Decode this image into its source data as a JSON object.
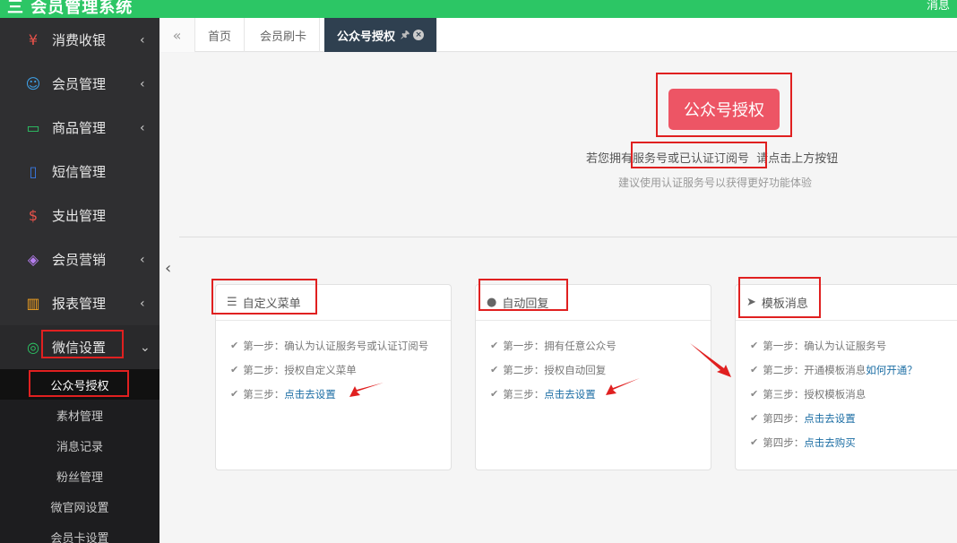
{
  "topbar": {
    "logo": "三 会员管理系统",
    "msg": "消息"
  },
  "sidebar": {
    "items": [
      {
        "label": "消费收银",
        "icon": "receipt-icon",
        "arrow": "‹"
      },
      {
        "label": "会员管理",
        "icon": "user-icon",
        "arrow": "‹"
      },
      {
        "label": "商品管理",
        "icon": "inbox-icon",
        "arrow": "‹"
      },
      {
        "label": "短信管理",
        "icon": "phone-icon",
        "arrow": ""
      },
      {
        "label": "支出管理",
        "icon": "coin-icon",
        "arrow": ""
      },
      {
        "label": "会员营销",
        "icon": "gift-icon",
        "arrow": "‹"
      },
      {
        "label": "报表管理",
        "icon": "chart-icon",
        "arrow": "‹"
      },
      {
        "label": "微信设置",
        "icon": "wechat-icon",
        "arrow": "⌄"
      }
    ],
    "sub": [
      "公众号授权",
      "素材管理",
      "消息记录",
      "粉丝管理",
      "微官网设置",
      "会员卡设置"
    ]
  },
  "tabs": {
    "collapse": "«",
    "items": [
      "首页",
      "会员刷卡",
      "公众号授权"
    ],
    "pin": "🖈",
    "close": "×"
  },
  "main": {
    "auth_button": "公众号授权",
    "hint_prefix": "若您拥有",
    "hint_highlight": "服务号或已认证订阅号",
    "hint_suffix": "请点击上方按钮",
    "hint2": "建议使用认证服务号以获得更好功能体验",
    "collapse_handle": "‹",
    "cards": [
      {
        "title": "自定义菜单",
        "icon": "list-icon",
        "steps": [
          {
            "text": "第一步：确认为认证服务号或认证订阅号",
            "link": ""
          },
          {
            "text": "第二步：授权自定义菜单",
            "link": ""
          },
          {
            "text": "第三步：",
            "link": "点击去设置"
          }
        ]
      },
      {
        "title": "自动回复",
        "icon": "comments-icon",
        "steps": [
          {
            "text": "第一步：拥有任意公众号",
            "link": ""
          },
          {
            "text": "第二步：授权自动回复",
            "link": ""
          },
          {
            "text": "第三步：",
            "link": "点击去设置"
          }
        ]
      },
      {
        "title": "模板消息",
        "icon": "send-icon",
        "steps": [
          {
            "text": "第一步：确认为认证服务号",
            "link": ""
          },
          {
            "text": "第二步：开通模板消息 ",
            "link": "如何开通？"
          },
          {
            "text": "第三步：授权模板消息",
            "link": ""
          },
          {
            "text": "第四步：",
            "link": "点击去设置"
          },
          {
            "text": "第四步：",
            "link": "点击去购买"
          }
        ]
      }
    ]
  },
  "colors": {
    "topbar": "#2cc665",
    "sidebar": "#2f2f31",
    "accent_red": "#ed5565",
    "link": "#1c6ea4",
    "annotation": "#e02020"
  }
}
